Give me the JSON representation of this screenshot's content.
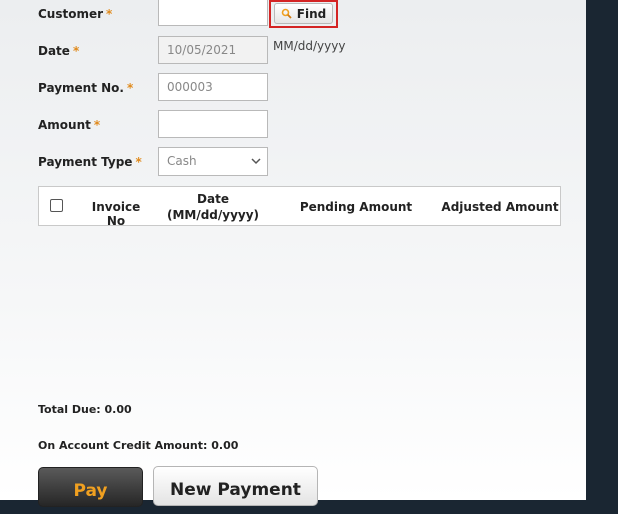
{
  "form": {
    "customer": {
      "label": "Customer",
      "required_mark": "*",
      "value": ""
    },
    "find_button": {
      "label": "Find",
      "icon": "search-icon"
    },
    "date": {
      "label": "Date",
      "required_mark": "*",
      "value": "10/05/2021",
      "format_hint": "MM/dd/yyyy"
    },
    "payment_no": {
      "label": "Payment No.",
      "required_mark": "*",
      "value": "000003"
    },
    "amount": {
      "label": "Amount",
      "required_mark": "*",
      "value": ""
    },
    "payment_type": {
      "label": "Payment Type",
      "required_mark": "*",
      "selected": "Cash"
    }
  },
  "grid": {
    "columns": [
      "Invoice No",
      "Date",
      "(MM/dd/yyyy)",
      "Pending Amount",
      "Adjusted Amount"
    ],
    "rows": []
  },
  "totals": {
    "total_due": "Total Due: 0.00",
    "on_account_credit": "On Account Credit Amount: 0.00"
  },
  "actions": {
    "pay": "Pay",
    "new_payment": "New Payment"
  },
  "colors": {
    "required": "#e08a1c",
    "highlight": "#d42424",
    "pay_text": "#f0a020",
    "background": "#1a2632"
  }
}
